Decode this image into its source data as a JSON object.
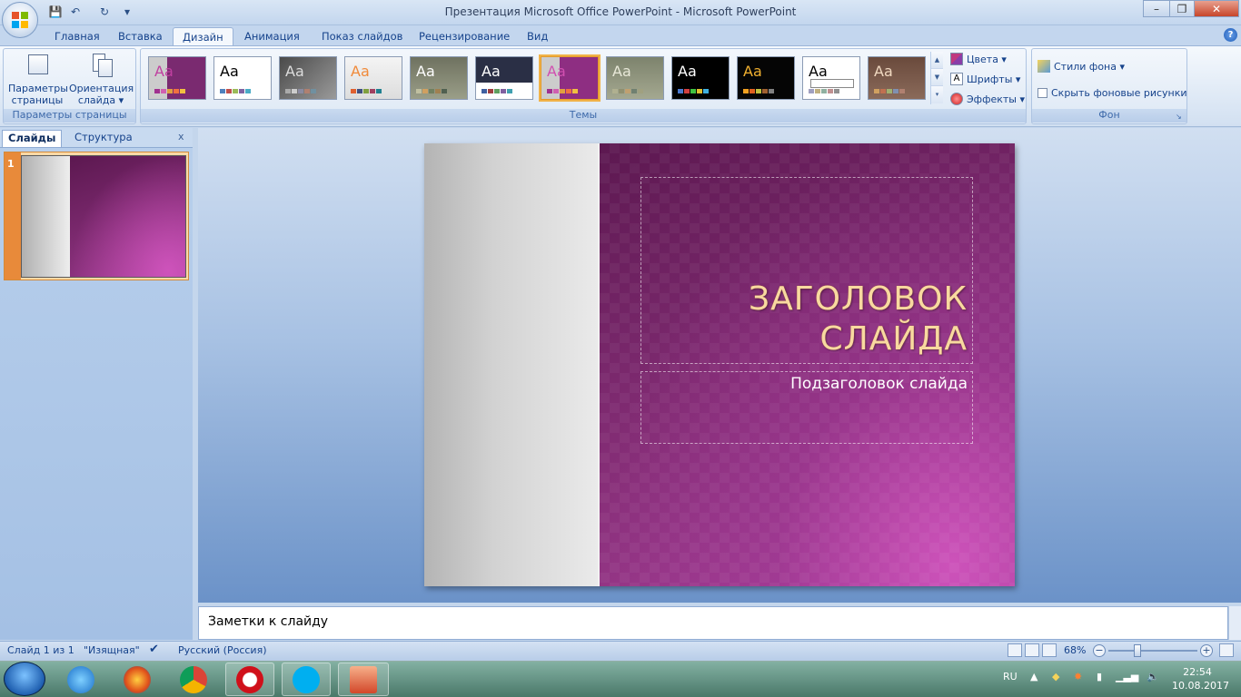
{
  "window": {
    "title": "Презентация Microsoft Office PowerPoint - Microsoft PowerPoint",
    "minimize": "–",
    "maximize": "❐",
    "close": "✕"
  },
  "qat": {
    "save": "💾",
    "undo": "↶",
    "redo": "↻",
    "more": "▾"
  },
  "tabs": [
    "Главная",
    "Вставка",
    "Дизайн",
    "Анимация",
    "Показ слайдов",
    "Рецензирование",
    "Вид"
  ],
  "active_tab": "Дизайн",
  "ribbon": {
    "page_setup": {
      "group_label": "Параметры страницы",
      "params_label_1": "Параметры",
      "params_label_2": "страницы",
      "orientation_label_1": "Ориентация",
      "orientation_label_2": "слайда ▾"
    },
    "themes": {
      "group_label": "Темы",
      "aa": "Aa",
      "colors": "Цвета ▾",
      "fonts": "Шрифты ▾",
      "effects": "Эффекты ▾"
    },
    "background": {
      "group_label": "Фон",
      "styles": "Стили фона ▾",
      "hide": "Скрыть фоновые рисунки"
    }
  },
  "left_pane": {
    "tab_slides": "Слайды",
    "tab_outline": "Структура",
    "close": "x",
    "slide_number": "1"
  },
  "slide": {
    "title": "ЗАГОЛОВОК\nСЛАЙДА",
    "subtitle": "Подзаголовок слайда"
  },
  "notes": {
    "placeholder": "Заметки к слайду"
  },
  "status": {
    "slide_info": "Слайд 1 из 1",
    "theme_name": "\"Изящная\"",
    "language": "Русский (Россия)",
    "zoom": "68%"
  },
  "tray": {
    "lang": "RU",
    "time": "22:54",
    "date": "10.08.2017"
  },
  "colors": {
    "accent": "#15428b",
    "slide_purple": "#7e2a70",
    "title_gold": "#f8d9a0"
  }
}
